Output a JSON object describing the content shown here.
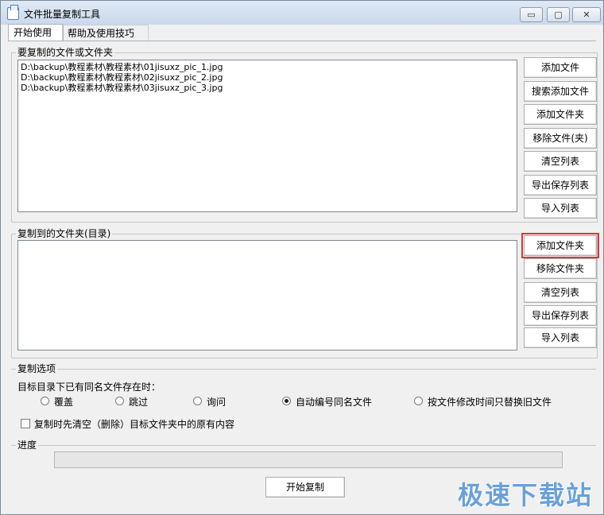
{
  "window": {
    "title": "文件批量复制工具"
  },
  "tabs": {
    "start": "开始使用",
    "help": "帮助及使用技巧"
  },
  "source": {
    "label": "要复制的文件或文件夹",
    "files": [
      "D:\\backup\\教程素材\\教程素材\\01jisuxz_pic_1.jpg",
      "D:\\backup\\教程素材\\教程素材\\02jisuxz_pic_2.jpg",
      "D:\\backup\\教程素材\\教程素材\\03jisuxz_pic_3.jpg"
    ],
    "buttons": [
      "添加文件",
      "搜索添加文件",
      "添加文件夹",
      "移除文件(夹)",
      "清空列表",
      "导出保存列表",
      "导入列表"
    ]
  },
  "destination": {
    "label": "复制到的文件夹(目录)",
    "buttons": [
      "添加文件夹",
      "移除文件夹",
      "清空列表",
      "导出保存列表",
      "导入列表"
    ]
  },
  "options": {
    "label": "复制选项",
    "prompt": "目标目录下已有同名文件存在时：",
    "radios": [
      "覆盖",
      "跳过",
      "询问",
      "自动编号同名文件",
      "按文件修改时间只替换旧文件"
    ],
    "selected": "自动编号同名文件",
    "clear_checkbox": "复制时先清空（删除）目标文件夹中的原有内容",
    "clear_checked": false
  },
  "progress": {
    "label": "进度",
    "value": 0
  },
  "start_button": "开始复制",
  "watermark": "极速下载站"
}
